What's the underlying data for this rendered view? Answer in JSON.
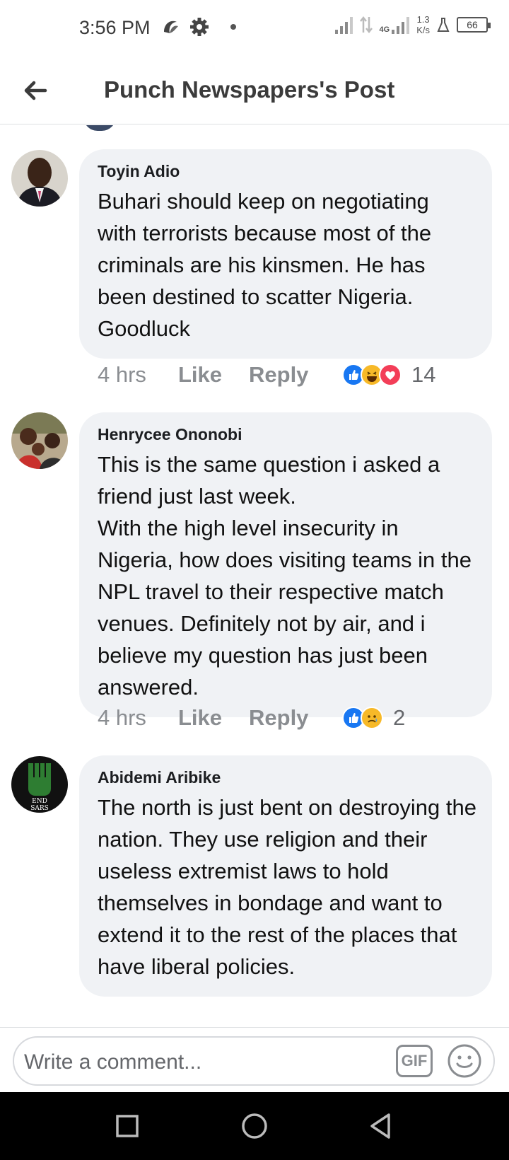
{
  "status_bar": {
    "time": "3:56 PM",
    "network_type": "4G",
    "speed_value": "1.3",
    "speed_unit": "K/s",
    "battery": "66"
  },
  "header": {
    "title": "Punch Newspapers's Post"
  },
  "comments": [
    {
      "author": "Toyin Adio",
      "text": "Buhari should keep on negotiating with terrorists because most of the criminals are his kinsmen. He has been destined to scatter Nigeria. Goodluck",
      "time": "4 hrs",
      "like_label": "Like",
      "reply_label": "Reply",
      "reactions": [
        "like",
        "haha",
        "love"
      ],
      "reaction_count": "14"
    },
    {
      "author": "Henrycee Ononobi",
      "text": "This is the same question i asked a friend just last week.\nWith the high level insecurity in Nigeria, how does visiting teams in the NPL travel to their respective match venues.  Definitely not by air, and i believe my question has just been answered.",
      "time": "4 hrs",
      "like_label": "Like",
      "reply_label": "Reply",
      "reactions": [
        "like",
        "sad"
      ],
      "reaction_count": "2"
    },
    {
      "author": "Abidemi Aribike",
      "text": "The north is just bent on destroying the nation. They use religion and their useless extremist laws to hold themselves in bondage and want to extend it to the rest of the places that have liberal policies.",
      "avatar_text": "END SARS"
    }
  ],
  "composer": {
    "placeholder": "Write a comment...",
    "gif_label": "GIF"
  },
  "colors": {
    "bubble": "#f0f2f5",
    "like_blue": "#1877f2",
    "muted": "#8a8d91"
  }
}
